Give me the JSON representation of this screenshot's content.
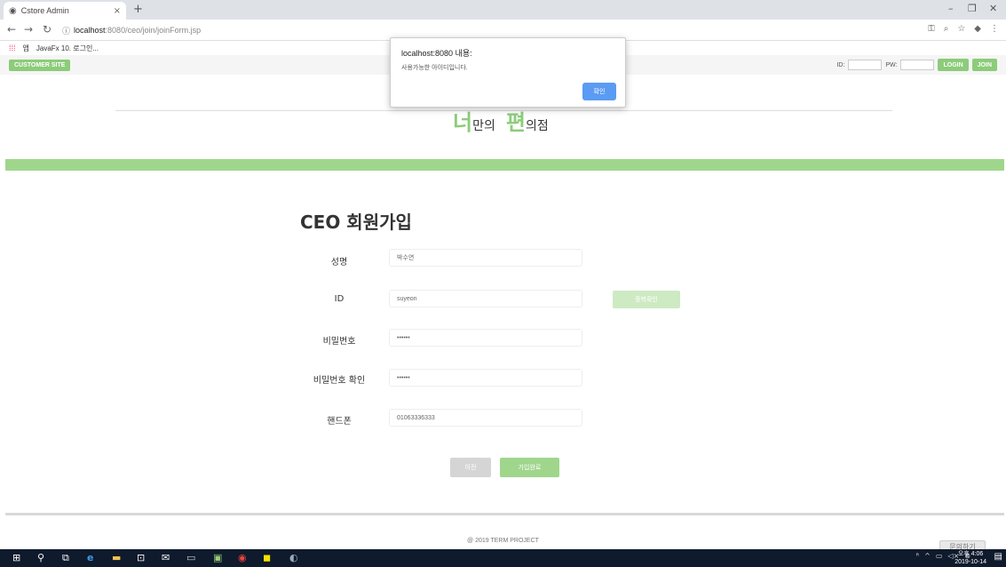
{
  "browser": {
    "tab_title": "Cstore Admin",
    "tab_close": "×",
    "new_tab": "+",
    "url_host": "localhost",
    "url_path": ":8080/ceo/join/joinForm.jsp",
    "bookmarks": [
      "앱",
      "JavaFx 10. 로그인..."
    ]
  },
  "topbar": {
    "customer_site": "CUSTOMER SITE",
    "id_label": "ID:",
    "pw_label": "PW:",
    "login": "LOGIN",
    "join": "JOIN"
  },
  "logo": {
    "char1": "너",
    "text1": "만의",
    "char2": "편",
    "text2": "의점"
  },
  "form": {
    "title": "CEO 회원가입",
    "name_label": "성명",
    "name_value": "박수연",
    "id_label": "ID",
    "id_value": "suyeon",
    "dup_check": "중복확인",
    "pw_label": "비밀번호",
    "pw_value": "••••••",
    "pw_confirm_label": "비밀번호 확인",
    "pw_confirm_value": "••••••",
    "phone_label": "핸드폰",
    "phone_value": "01063336333",
    "prev": "이전",
    "submit": "가입완료"
  },
  "footer": {
    "copyright": "@ 2019 TERM PROJECT",
    "float_button": "문의하기"
  },
  "dialog": {
    "title": "localhost:8080 내용:",
    "message": "사용가능한 아이디입니다.",
    "ok": "확인"
  },
  "taskbar": {
    "time": "오후 4:06",
    "date": "2019-10-14"
  },
  "colors": {
    "accent_green": "#8ccc7a",
    "dialog_blue": "#5b9bf3"
  }
}
